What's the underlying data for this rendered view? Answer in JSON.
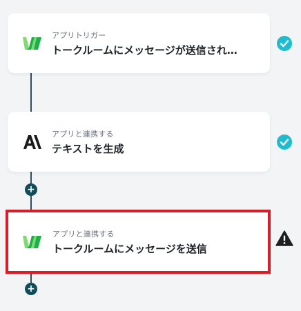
{
  "flow": {
    "steps": [
      {
        "app_name": "yoom-chatwork-logo",
        "subtitle": "アプリトリガー",
        "title": "トークルームにメッセージが送信され…",
        "status": "check-icon"
      },
      {
        "app_name": "anthropic-logo",
        "subtitle": "アプリと連携する",
        "title": "テキストを生成",
        "status": "check-icon"
      },
      {
        "app_name": "yoom-chatwork-logo",
        "subtitle": "アプリと連携する",
        "title": "トークルームにメッセージを送信",
        "status": "warning-icon",
        "highlighted": true
      }
    ],
    "add_button_label": "+"
  },
  "colors": {
    "check": "#1fbcd0",
    "warning": "#1f1f1f",
    "highlight_border": "#e21a23",
    "connector": "#2b4d5c",
    "add_button": "#0f4c5c",
    "logo_green_dark": "#1bb04a",
    "logo_green_light": "#7ddc6a"
  }
}
